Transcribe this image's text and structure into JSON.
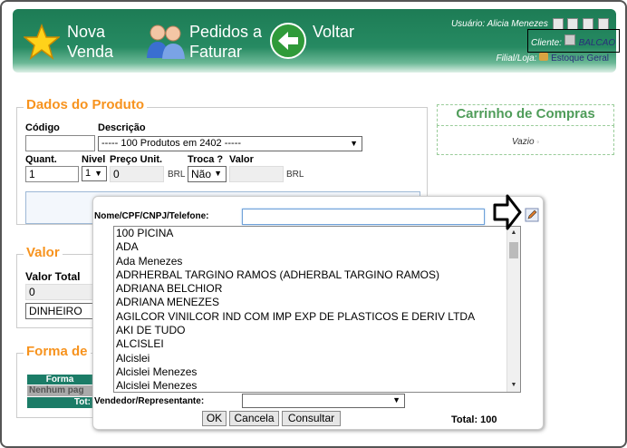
{
  "header": {
    "nova_venda": [
      "Nova",
      "Venda"
    ],
    "pedidos": [
      "Pedidos a",
      "Faturar"
    ],
    "voltar": "Voltar",
    "usuario_label": "Usuário:",
    "usuario": "Alicia Menezes",
    "cliente_label": "Cliente:",
    "cliente": "BALCAO",
    "filial_label": "Filial/Loja:",
    "filial": "Estoque Geral"
  },
  "produto": {
    "title": "Dados do Produto",
    "codigo_label": "Código",
    "codigo_value": "",
    "descricao_label": "Descrição",
    "descricao_value": "----- 100 Produtos em 2402 -----",
    "quant_label": "Quant.",
    "quant_value": "1",
    "nivel_label": "Nivel",
    "nivel_value": "1",
    "preco_label": "Preço Unit.",
    "preco_value": "0",
    "brl": "BRL",
    "troca_label": "Troca ?",
    "troca_value": "Não",
    "valor_label": "Valor",
    "valor_value": "",
    "brl2": "BRL"
  },
  "carrinho": {
    "title": "Carrinho de Compras",
    "empty": "Vazio"
  },
  "valor": {
    "title": "Valor",
    "total_label": "Valor Total",
    "total_value": "0",
    "pagamento": "DINHEIRO"
  },
  "forma": {
    "title": "Forma de",
    "col": "Forma",
    "row": "Nenhum pag",
    "total": "Tot:"
  },
  "dialog": {
    "search_label": "Nome/CPF/CNPJ/Telefone:",
    "search_value": "",
    "items": [
      "100 PICINA",
      "ADA",
      "Ada Menezes",
      "ADRHERBAL TARGINO RAMOS (ADHERBAL TARGINO RAMOS)",
      "ADRIANA BELCHIOR",
      "ADRIANA MENEZES",
      "AGILCOR VINILCOR IND COM IMP EXP DE PLASTICOS E DERIV LTDA",
      "AKI DE TUDO",
      "ALCISLEI",
      "Alcislei",
      "Alcislei Menezes",
      "Alcislei Menezes"
    ],
    "vendedor_label": "Vendedor/Representante:",
    "vendedor_value": "",
    "ok": "OK",
    "cancela": "Cancela",
    "consultar": "Consultar",
    "total": "Total: 100"
  }
}
